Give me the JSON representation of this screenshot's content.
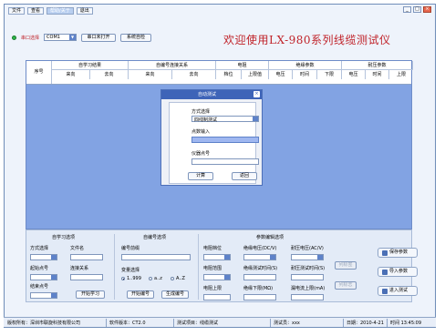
{
  "menu": {
    "items": [
      "文件",
      "查看",
      "帮助/关于",
      "退出"
    ]
  },
  "window_controls": [
    "_",
    "□",
    "×"
  ],
  "toolbar": {
    "port_label": "串口选择",
    "port_value": "COM1",
    "open_port_button": "串口未打开",
    "self_check_button": "系统自检"
  },
  "app_title": "欢迎使用LX-980系列线缆测试仪",
  "table": {
    "row_no_header": "序号",
    "groups": [
      "自学习结果",
      "自编号连接关系",
      "电阻",
      "绝缘参数",
      "耐压参数"
    ],
    "sub_headers": [
      "来向",
      "去向",
      "来向",
      "去向",
      "档位",
      "上限值",
      "电压",
      "时间",
      "下限",
      "电压",
      "时间",
      "上限"
    ]
  },
  "self_learn": {
    "title": "自学习选项",
    "mode_label": "方式选择",
    "filename_label": "文件名",
    "start_label": "起始点号",
    "relation_label": "连接关系",
    "end_label": "结束点号",
    "start_button": "开始学习"
  },
  "self_number": {
    "title": "自编号选项",
    "prefix_label": "编号前缀",
    "format_label": "变量选择",
    "radio_options": [
      "1..999",
      "a..z",
      "A..Z"
    ],
    "open_button": "开始编号",
    "done_button": "生成编号"
  },
  "param_setup": {
    "title": "参数编辑选项",
    "res_range_label": "电阻档位",
    "res_limit_label": "电阻范围",
    "res_upper_label": "电阻上限",
    "ins_voltage_label": "绝缘电压(DC/V)",
    "ins_time_label": "绝缘测试时间(S)",
    "ins_lower_label": "绝缘下限(MΩ)",
    "hv_voltage_label": "耐压电压(AC/V)",
    "hv_time_label": "耐压测试时间(S)",
    "leak_label": "漏电流上限(mA)",
    "apply_button": "列标签",
    "apply2_button": "列标志"
  },
  "side_buttons": [
    "保存参数",
    "导入参数",
    "进入测试"
  ],
  "status_bar": {
    "company": "版权所有：深圳市联旋科技有限公司",
    "software_version": "软件版本：CT2.0",
    "test_item": "测试项目：线缆测试",
    "tester": "测试员：xxx",
    "date": "日期：2010-4-21",
    "time": "时间 13:45:09"
  },
  "dialog": {
    "title": "自动测试",
    "method_label": "方式选择",
    "method_value": "四线制测试",
    "points_label": "点数输入",
    "device_label": "仪器点号",
    "calc_button": "计算",
    "back_button": "返回"
  },
  "colors": {
    "title_red": "#c0232a",
    "grid_blue": "#82a3e3",
    "dialog_blue": "#3e64b8",
    "led_green": "#2fb84a"
  }
}
